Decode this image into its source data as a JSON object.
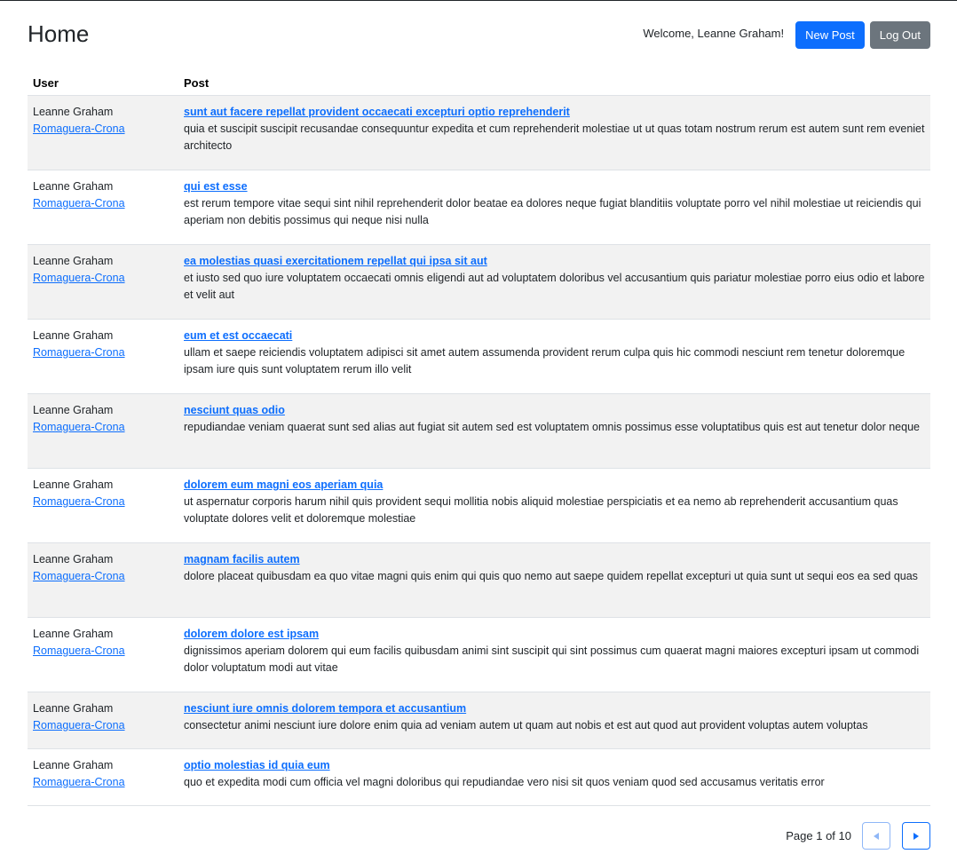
{
  "header": {
    "title": "Home",
    "welcome": "Welcome, Leanne Graham!",
    "new_post_label": "New Post",
    "log_out_label": "Log Out"
  },
  "table": {
    "columns": [
      "User",
      "Post"
    ],
    "rows": [
      {
        "user": "Leanne Graham",
        "company": "Romaguera-Crona",
        "title": "sunt aut facere repellat provident occaecati excepturi optio reprehenderit",
        "body": "quia et suscipit suscipit recusandae consequuntur expedita et cum reprehenderit molestiae ut ut quas totam nostrum rerum est autem sunt rem eveniet architecto"
      },
      {
        "user": "Leanne Graham",
        "company": "Romaguera-Crona",
        "title": "qui est esse",
        "body": "est rerum tempore vitae sequi sint nihil reprehenderit dolor beatae ea dolores neque fugiat blanditiis voluptate porro vel nihil molestiae ut reiciendis qui aperiam non debitis possimus qui neque nisi nulla"
      },
      {
        "user": "Leanne Graham",
        "company": "Romaguera-Crona",
        "title": "ea molestias quasi exercitationem repellat qui ipsa sit aut",
        "body": "et iusto sed quo iure voluptatem occaecati omnis eligendi aut ad voluptatem doloribus vel accusantium quis pariatur molestiae porro eius odio et labore et velit aut"
      },
      {
        "user": "Leanne Graham",
        "company": "Romaguera-Crona",
        "title": "eum et est occaecati",
        "body": "ullam et saepe reiciendis voluptatem adipisci sit amet autem assumenda provident rerum culpa quis hic commodi nesciunt rem tenetur doloremque ipsam iure quis sunt voluptatem rerum illo velit"
      },
      {
        "user": "Leanne Graham",
        "company": "Romaguera-Crona",
        "title": "nesciunt quas odio",
        "body": "repudiandae veniam quaerat sunt sed alias aut fugiat sit autem sed est voluptatem omnis possimus esse voluptatibus quis est aut tenetur dolor neque"
      },
      {
        "user": "Leanne Graham",
        "company": "Romaguera-Crona",
        "title": "dolorem eum magni eos aperiam quia",
        "body": "ut aspernatur corporis harum nihil quis provident sequi mollitia nobis aliquid molestiae perspiciatis et ea nemo ab reprehenderit accusantium quas voluptate dolores velit et doloremque molestiae"
      },
      {
        "user": "Leanne Graham",
        "company": "Romaguera-Crona",
        "title": "magnam facilis autem",
        "body": "dolore placeat quibusdam ea quo vitae magni quis enim qui quis quo nemo aut saepe quidem repellat excepturi ut quia sunt ut sequi eos ea sed quas"
      },
      {
        "user": "Leanne Graham",
        "company": "Romaguera-Crona",
        "title": "dolorem dolore est ipsam",
        "body": "dignissimos aperiam dolorem qui eum facilis quibusdam animi sint suscipit qui sint possimus cum quaerat magni maiores excepturi ipsam ut commodi dolor voluptatum modi aut vitae"
      },
      {
        "user": "Leanne Graham",
        "company": "Romaguera-Crona",
        "title": "nesciunt iure omnis dolorem tempora et accusantium",
        "body": "consectetur animi nesciunt iure dolore enim quia ad veniam autem ut quam aut nobis et est aut quod aut provident voluptas autem voluptas"
      },
      {
        "user": "Leanne Graham",
        "company": "Romaguera-Crona",
        "title": "optio molestias id quia eum",
        "body": "quo et expedita modi cum officia vel magni doloribus qui repudiandae vero nisi sit quos veniam quod sed accusamus veritatis error"
      }
    ]
  },
  "pagination": {
    "page_info": "Page 1 of 10",
    "prev_icon": "triangle-left-icon",
    "next_icon": "triangle-right-icon"
  }
}
